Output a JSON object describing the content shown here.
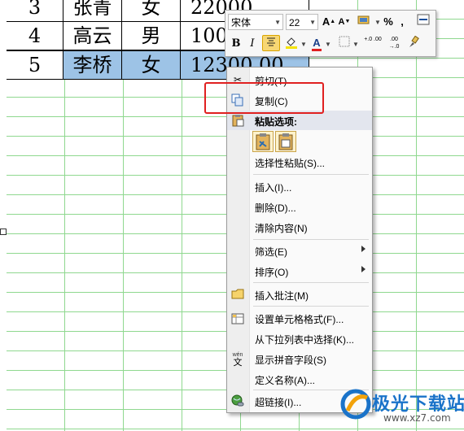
{
  "sheet": {
    "rows": [
      {
        "num": "3",
        "name": "张青",
        "gender": "女",
        "amount": "22000"
      },
      {
        "num": "4",
        "name": "高云",
        "gender": "男",
        "amount": "100"
      },
      {
        "num": "5",
        "name": "李桥",
        "gender": "女",
        "amount": "12300.00"
      }
    ]
  },
  "mini_toolbar": {
    "font_name": "宋体",
    "font_size": "22",
    "grow_font": "A",
    "shrink_font": "A",
    "percent": "%",
    "comma": ",",
    "bold": "B",
    "italic": "I",
    "font_color_letter": "A",
    "increase_decimal": "+.0 .00",
    "decrease_decimal": ".00 →.0"
  },
  "context_menu": {
    "items": {
      "cut": "剪切(T)",
      "copy": "复制(C)",
      "paste_options": "粘贴选项:",
      "paste_special": "选择性粘贴(S)...",
      "insert": "插入(I)...",
      "delete": "删除(D)...",
      "clear_contents": "清除内容(N)",
      "filter": "筛选(E)",
      "sort": "排序(O)",
      "insert_comment": "插入批注(M)",
      "format_cells": "设置单元格格式(F)...",
      "pick_from_list": "从下拉列表中选择(K)...",
      "show_phonetic": "显示拼音字段(S)",
      "define_name": "定义名称(A)...",
      "hyperlink": "超链接(I)..."
    },
    "phonetic_icon_text": "wén",
    "phonetic_icon_char": "文"
  },
  "watermark": {
    "brand": "极光下载站",
    "url": "www.xz7.com"
  },
  "colors": {
    "selection": "#9dc3e6",
    "grid": "#8fd88f",
    "highlight": "#e02020",
    "watermark_blue": "#1a73c9"
  }
}
